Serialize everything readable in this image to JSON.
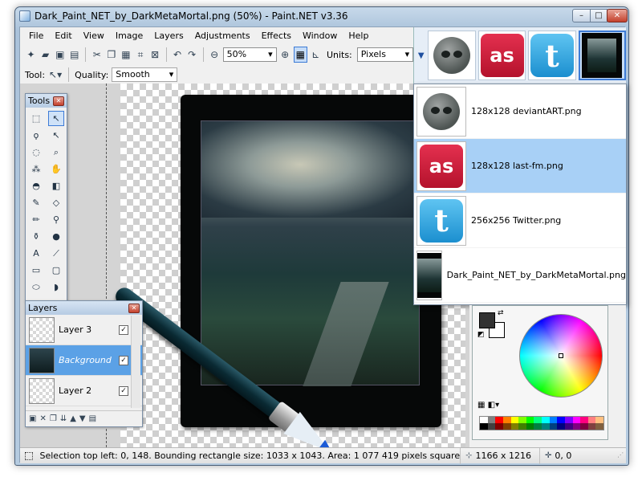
{
  "window": {
    "title": "Dark_Paint_NET_by_DarkMetaMortal.png (50%) - Paint.NET v3.36",
    "min_label": "–",
    "max_label": "□",
    "close_label": "✕"
  },
  "menu": [
    "File",
    "Edit",
    "View",
    "Image",
    "Layers",
    "Adjustments",
    "Effects",
    "Window",
    "Help"
  ],
  "toolbar": {
    "zoom_value": "50%",
    "units_label": "Units:",
    "units_value": "Pixels"
  },
  "toolbar2": {
    "tool_label": "Tool:",
    "quality_label": "Quality:",
    "quality_value": "Smooth"
  },
  "tools_panel": {
    "title": "Tools"
  },
  "layers_panel": {
    "title": "Layers",
    "layers": [
      {
        "name": "Layer 3",
        "visible": true
      },
      {
        "name": "Background",
        "visible": true
      },
      {
        "name": "Layer 2",
        "visible": true
      }
    ]
  },
  "image_list": [
    {
      "name": "128x128 deviantART.png"
    },
    {
      "name": "128x128 last-fm.png"
    },
    {
      "name": "256x256 Twitter.png"
    },
    {
      "name": "Dark_Paint_NET_by_DarkMetaMortal.png"
    }
  ],
  "thumb_text": {
    "lastfm": "as",
    "twitter": "t"
  },
  "statusbar": {
    "selection": "Selection top left: 0, 148. Bounding rectangle size: 1033 x 1043. Area: 1 077 419 pixels square",
    "image_size": "1166 x 1216",
    "cursor": "0, 0"
  },
  "colors": {
    "primary": "#323232",
    "secondary": "#ffffff",
    "accent": "#3d7bd6",
    "hover": "#a8d0f6"
  },
  "palette": [
    "#ffffff",
    "#808080",
    "#ff0000",
    "#ff7f00",
    "#ffff00",
    "#7fff00",
    "#00ff00",
    "#00ff7f",
    "#00ffff",
    "#007fff",
    "#0000ff",
    "#7f00ff",
    "#ff00ff",
    "#ff007f",
    "#ff8080",
    "#ffc080",
    "#000000",
    "#404040",
    "#800000",
    "#804000",
    "#808000",
    "#408000",
    "#008000",
    "#008040",
    "#008080",
    "#004080",
    "#000080",
    "#400080",
    "#800080",
    "#800040",
    "#804040",
    "#806040"
  ]
}
